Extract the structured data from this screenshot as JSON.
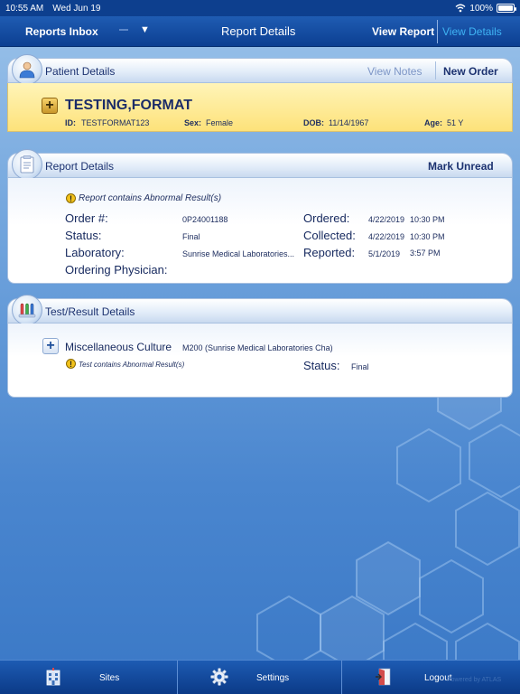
{
  "status_bar": {
    "time": "10:55 AM",
    "date": "Wed Jun 19",
    "battery": "100%",
    "battery_level": 1.0
  },
  "nav": {
    "inbox_label": "Reports Inbox",
    "title": "Report Details",
    "view_report_label": "View Report",
    "view_details_label": "View Details"
  },
  "patient": {
    "section_title": "Patient Details",
    "view_notes_label": "View Notes",
    "new_order_label": "New Order",
    "name": "TESTING,FORMAT",
    "id_label": "ID:",
    "id": "TESTFORMAT123",
    "sex_label": "Sex:",
    "sex": "Female",
    "dob_label": "DOB:",
    "dob": "11/14/1967",
    "age_label": "Age:",
    "age": "51 Y"
  },
  "report": {
    "section_title": "Report Details",
    "mark_unread_label": "Mark Unread",
    "abnormal_notice": "Report contains Abnormal Result(s)",
    "order_label": "Order #:",
    "order": "0P24001188",
    "status_label": "Status:",
    "status": "Final",
    "laboratory_label": "Laboratory:",
    "laboratory": "Sunrise Medical Laboratories...",
    "physician_label": "Ordering Physician:",
    "ordered_label": "Ordered:",
    "ordered_date": "4/22/2019",
    "ordered_time": "10:30 PM",
    "collected_label": "Collected:",
    "collected_date": "4/22/2019",
    "collected_time": "10:30 PM",
    "reported_label": "Reported:",
    "reported_date": "5/1/2019",
    "reported_time": "3:57 PM"
  },
  "tests": {
    "section_title": "Test/Result Details",
    "items": [
      {
        "name": "Miscellaneous Culture",
        "code": "M200 (Sunrise Medical Laboratories Cha)",
        "abnormal_notice": "Test contains Abnormal Result(s)",
        "status_label": "Status:",
        "status": "Final"
      }
    ]
  },
  "toolbar": {
    "sites_label": "Sites",
    "settings_label": "Settings",
    "logout_label": "Logout",
    "watermark": "Powered by ATLAS"
  },
  "colors": {
    "navbar": "#0c3f92",
    "accent_link": "#3fb4f4",
    "patient_band": "#fde27a",
    "warning": "#f2c21b"
  }
}
